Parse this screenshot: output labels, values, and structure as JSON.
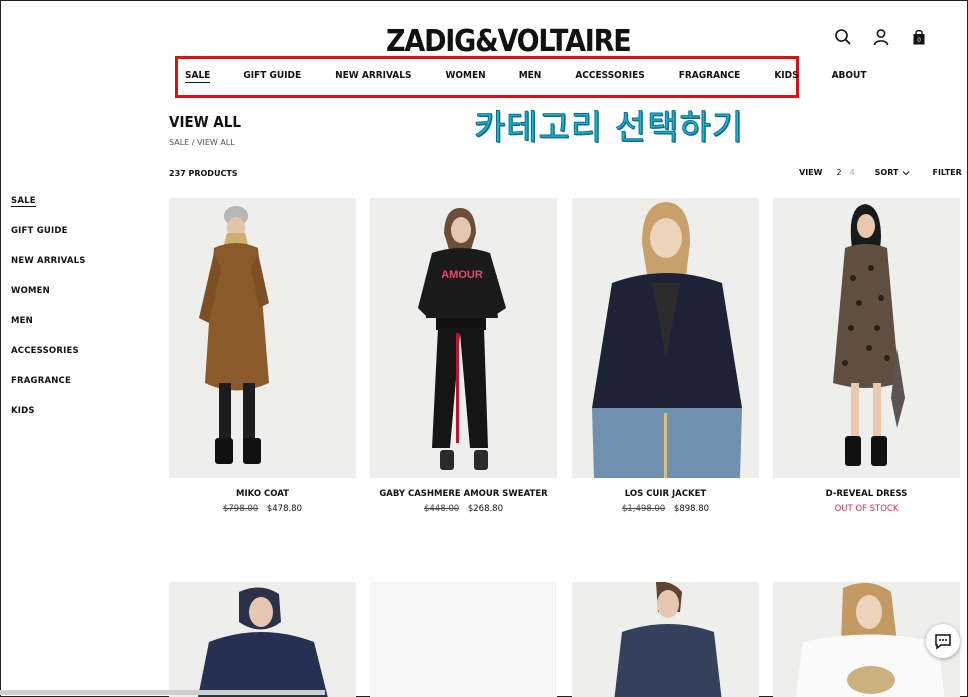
{
  "brand": {
    "logo_text": "ZADIG&VOLTAIRE"
  },
  "header_icons": [
    "search-icon",
    "user-icon",
    "bag-icon"
  ],
  "top_nav": [
    {
      "label": "SALE",
      "active": true
    },
    {
      "label": "GIFT GUIDE"
    },
    {
      "label": "NEW ARRIVALS"
    },
    {
      "label": "WOMEN"
    },
    {
      "label": "MEN"
    },
    {
      "label": "ACCESSORIES"
    },
    {
      "label": "FRAGRANCE"
    },
    {
      "label": "KIDS"
    },
    {
      "label": "ABOUT"
    }
  ],
  "annotation": "카테고리 선택하기",
  "annotation_color": "#19b6d8",
  "highlight_color": "#e01010",
  "page": {
    "title": "VIEW ALL",
    "breadcrumb": "SALE / VIEW ALL",
    "count": "237 PRODUCTS"
  },
  "toolbar": {
    "view_label": "VIEW",
    "view_options": [
      "2",
      "4"
    ],
    "sort_label": "SORT",
    "filter_label": "FILTER"
  },
  "sidebar": [
    {
      "label": "SALE",
      "active": true
    },
    {
      "label": "GIFT GUIDE"
    },
    {
      "label": "NEW ARRIVALS"
    },
    {
      "label": "WOMEN"
    },
    {
      "label": "MEN"
    },
    {
      "label": "ACCESSORIES"
    },
    {
      "label": "FRAGRANCE"
    },
    {
      "label": "KIDS"
    }
  ],
  "products": [
    {
      "name": "MIKO COAT",
      "old_price": "$798.00",
      "price": "$478.80"
    },
    {
      "name": "GABY CASHMERE AMOUR SWEATER",
      "old_price": "$448.00",
      "price": "$268.80",
      "print": "AMOUR"
    },
    {
      "name": "LOS CUIR JACKET",
      "old_price": "$1,498.00",
      "price": "$898.80"
    },
    {
      "name": "D-REVEAL DRESS",
      "status": "OUT OF STOCK"
    }
  ],
  "accent_colors": {
    "out_of_stock": "#d2294a",
    "text": "#111111"
  }
}
